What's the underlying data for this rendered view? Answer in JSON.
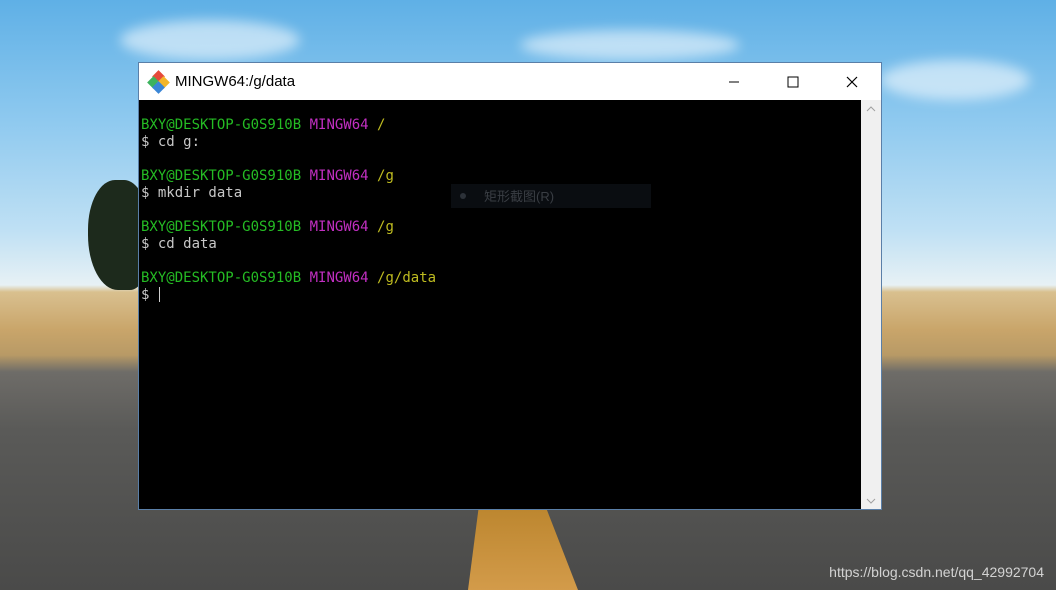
{
  "window": {
    "title": "MINGW64:/g/data",
    "icon": "git-diamond-icon",
    "controls": [
      "minimize-icon",
      "maximize-icon",
      "close-icon"
    ]
  },
  "terminal": {
    "lines": [
      {
        "user": "BXY@DESKTOP-G0S910B",
        "shell": "MINGW64",
        "path": "/"
      },
      {
        "cmd": "$ cd g:"
      },
      {
        "blank": ""
      },
      {
        "user": "BXY@DESKTOP-G0S910B",
        "shell": "MINGW64",
        "path": "/g"
      },
      {
        "cmd": "$ mkdir data"
      },
      {
        "blank": ""
      },
      {
        "user": "BXY@DESKTOP-G0S910B",
        "shell": "MINGW64",
        "path": "/g"
      },
      {
        "cmd": "$ cd data"
      },
      {
        "blank": ""
      },
      {
        "user": "BXY@DESKTOP-G0S910B",
        "shell": "MINGW64",
        "path": "/g/data"
      },
      {
        "cmd": "$ "
      }
    ],
    "colors": {
      "user": "#25bc24",
      "shell": "#c22fc2",
      "path": "#bfbc20",
      "text": "#c8c8c8",
      "background": "#000000"
    }
  },
  "tooltip": {
    "label": "矩形截图(R)"
  },
  "watermark": "https://blog.csdn.net/qq_42992704"
}
